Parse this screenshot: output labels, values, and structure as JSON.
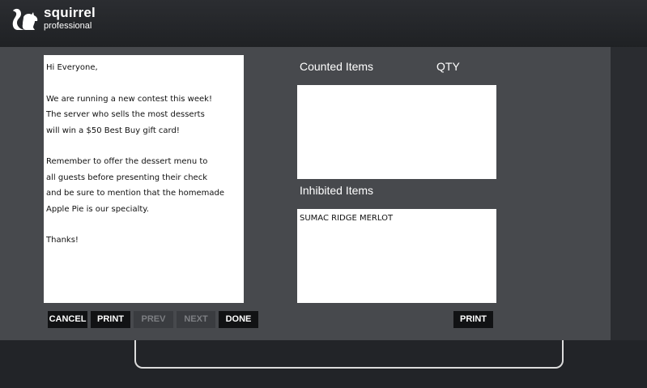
{
  "app": {
    "logo_line1": "squirrel",
    "logo_line2": "professional"
  },
  "message": {
    "lines": [
      "Hi Everyone,",
      "",
      "We are running a new contest this week!",
      "The server who sells the most desserts",
      "will win a $50 Best Buy gift card!",
      "",
      "Remember to offer the dessert menu to",
      "all guests before presenting their check",
      "and be sure to mention that the homemade",
      "Apple Pie is our specialty.",
      "",
      "Thanks!"
    ]
  },
  "counted": {
    "label": "Counted Items",
    "qty_label": "QTY",
    "items": []
  },
  "inhibited": {
    "label": "Inhibited Items",
    "items": [
      "SUMAC RIDGE MERLOT"
    ]
  },
  "buttons": {
    "cancel": "CANCEL",
    "print": "PRINT",
    "prev": "PREV",
    "next": "NEXT",
    "done": "DONE",
    "print_right": "PRINT"
  }
}
